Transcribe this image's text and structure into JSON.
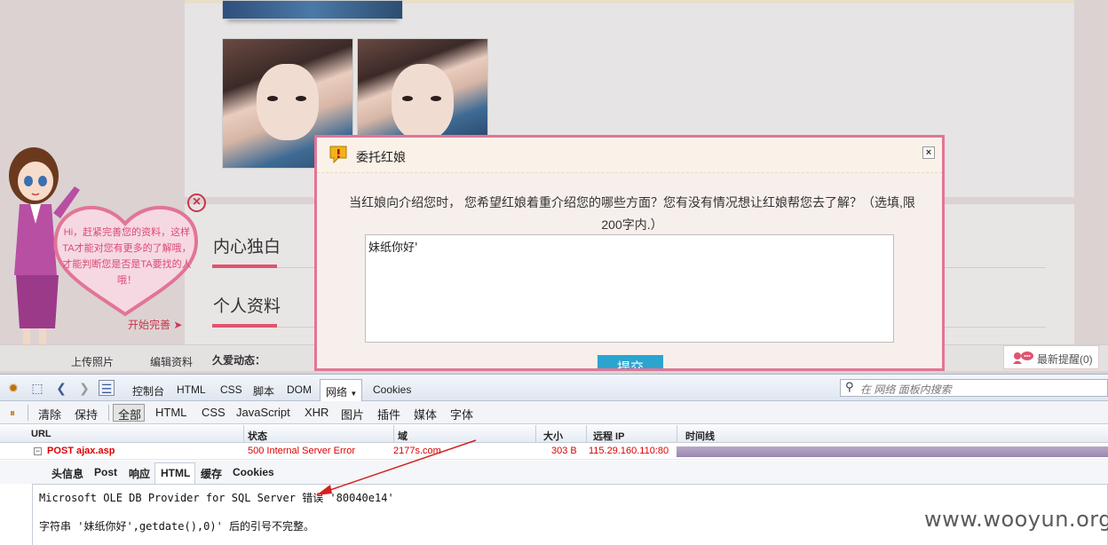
{
  "site": {
    "sections": [
      "内心独白",
      "个人资料"
    ],
    "hostess_bubble": "Hi，赶紧完善您的资料，这样TA才能对您有更多的了解哦，才能判断您是否是TA要找的人哦！",
    "start_link": "开始完善",
    "nav": {
      "upload": "上传照片",
      "edit": "编辑资料",
      "dynamic": "久爱动态："
    },
    "reminder": "最新提醒(0)"
  },
  "dialog": {
    "title": "委托红娘",
    "prompt": "当红娘向介绍您时， 您希望红娘着重介绍您的哪些方面？您有没有情况想让红娘帮您去了解？（选填,限200字内.）",
    "textarea_value": "妹纸你好'",
    "submit_label": "提交",
    "close_glyph": "×"
  },
  "firebug": {
    "tabs": [
      "控制台",
      "HTML",
      "CSS",
      "脚本",
      "DOM",
      "网络",
      "Cookies"
    ],
    "active_tab": "网络",
    "search_placeholder": "在 网络 面板内搜索",
    "actions": {
      "clear": "清除",
      "persist": "保持"
    },
    "filters": [
      "全部",
      "HTML",
      "CSS",
      "JavaScript",
      "XHR",
      "图片",
      "插件",
      "媒体",
      "字体"
    ],
    "columns": {
      "url": "URL",
      "status": "状态",
      "domain": "域",
      "size": "大小",
      "remote_ip": "远程 IP",
      "timeline": "时间线"
    },
    "request": {
      "url": "POST ajax.asp",
      "status": "500 Internal Server Error",
      "domain": "2177s.com",
      "size": "303 B",
      "remote_ip": "115.29.160.110:80"
    },
    "detail_tabs": [
      "头信息",
      "Post",
      "响应",
      "HTML",
      "缓存",
      "Cookies"
    ],
    "active_detail_tab": "HTML",
    "response_lines": [
      "Microsoft OLE DB Provider for SQL Server 错误 '80040e14'",
      "字符串 '妹纸你好',getdate(),0)' 后的引号不完整。"
    ]
  },
  "watermark": "www.wooyun.org",
  "colors": {
    "accent_pink": "#e0546f",
    "dialog_border": "#e27596",
    "submit_blue": "#2aa5cf",
    "error_red": "#dd0000"
  }
}
